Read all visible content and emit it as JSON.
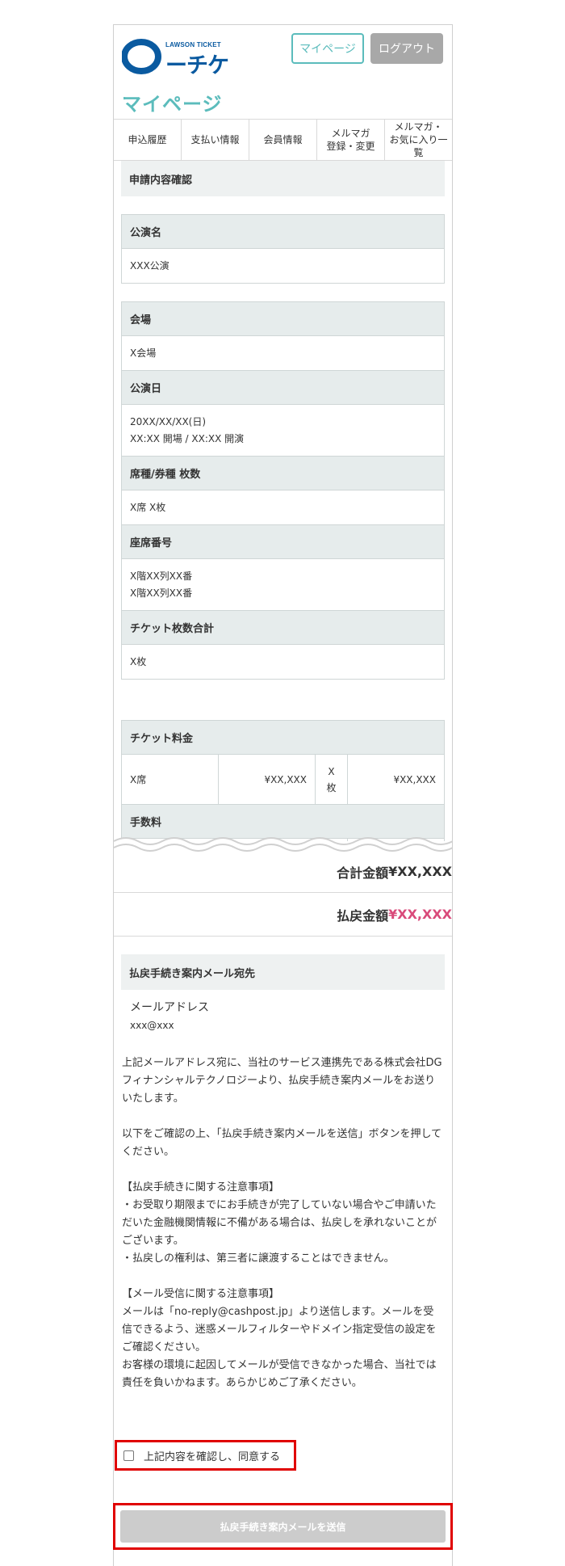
{
  "header": {
    "logo_small": "LAWSON TICKET",
    "logo_kana": "ーチケ",
    "mypage_button": "マイページ",
    "logout_button": "ログアウト",
    "page_title": "マイページ"
  },
  "tabs": [
    {
      "label": "申込履歴"
    },
    {
      "label": "支払い情報"
    },
    {
      "label": "会員情報"
    },
    {
      "label": "メルマガ\n登録・変更"
    },
    {
      "label": "メルマガ・\nお気に入り一覧"
    }
  ],
  "application": {
    "section_title": "申請内容確認",
    "performance_label": "公演名",
    "performance_value": "XXX公演",
    "venue_label": "会場",
    "venue_value": "X会場",
    "date_label": "公演日",
    "date_value": "20XX/XX/XX(日)\nXX:XX 開場 / XX:XX 開演",
    "seat_type_label": "席種/券種 枚数",
    "seat_type_value": "X席 X枚",
    "seat_number_label": "座席番号",
    "seat_number_value": "X階XX列XX番\nX階XX列XX番",
    "ticket_count_label": "チケット枚数合計",
    "ticket_count_value": "X枚"
  },
  "fees": {
    "ticket_fee_label": "チケット料金",
    "row": {
      "seat": "X席",
      "unit_price": "¥XX,XXX",
      "qty": "X\n枚",
      "subtotal": "¥XX,XXX"
    },
    "handling_label": "手数料"
  },
  "totals": {
    "total_label": "合計金額 ",
    "total_value": "¥XX,XXX",
    "refund_label": "払戻金額 ",
    "refund_value": "¥XX,XXX"
  },
  "mail": {
    "section_title": "払戻手続き案内メール宛先",
    "address_label": "メールアドレス",
    "address_value": "xxx@xxx",
    "paragraph1": "上記メールアドレス宛に、当社のサービス連携先である株式会社DGフィナンシャルテクノロジーより、払戻手続き案内メールをお送りいたします。",
    "paragraph2": "以下をご確認の上、「払戻手続き案内メールを送信」ボタンを押してください。",
    "notes1_title": "【払戻手続きに関する注意事項】",
    "notes1_body": "・お受取り期限までにお手続きが完了していない場合やご申請いただいた金融機関情報に不備がある場合は、払戻しを承れないことがございます。\n・払戻しの権利は、第三者に譲渡することはできません。",
    "notes2_title": "【メール受信に関する注意事項】",
    "notes2_body": "メールは「no-reply@cashpost.jp」より送信します。メールを受信できるよう、迷惑メールフィルターやドメイン指定受信の設定をご確認ください。\nお客様の環境に起因してメールが受信できなかった場合、当社では責任を負いかねます。あらかじめご了承ください。"
  },
  "agree": {
    "label": "上記内容を確認し、同意する"
  },
  "submit": {
    "label": "払戻手続き案内メールを送信"
  },
  "colors": {
    "accent": "#5bbcbc",
    "brand": "#0a5aa0",
    "highlight": "#e00000",
    "refund": "#d94a7a"
  }
}
